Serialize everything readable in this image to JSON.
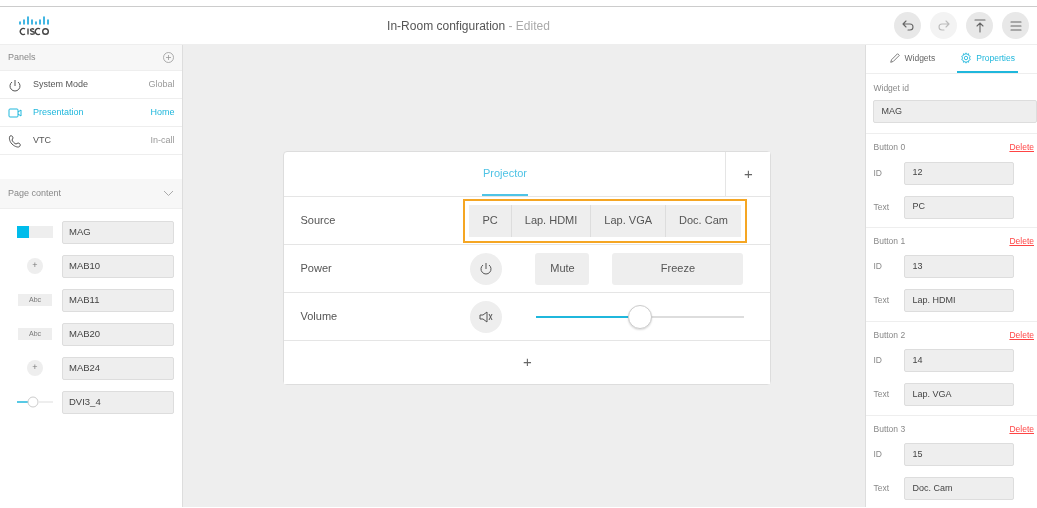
{
  "header": {
    "title": "In-Room configuration",
    "status": "- Edited",
    "actions": [
      {
        "kind": "undo",
        "disabled": false
      },
      {
        "kind": "redo",
        "disabled": true
      },
      {
        "kind": "upload",
        "disabled": false
      },
      {
        "kind": "menu",
        "disabled": false
      }
    ]
  },
  "sidebar": {
    "panels_title": "Panels",
    "panels": [
      {
        "label": "System Mode",
        "scope": "Global",
        "selected": false
      },
      {
        "label": "Presentation",
        "scope": "Home",
        "selected": true
      },
      {
        "label": "VTC",
        "scope": "In-call",
        "selected": false
      }
    ],
    "page_content_title": "Page content",
    "widgets": [
      {
        "kind": "toggle",
        "id": "MAG"
      },
      {
        "kind": "button",
        "id": "MAB10",
        "glyph": "+"
      },
      {
        "kind": "text",
        "id": "MAB11",
        "glyph": "Abc"
      },
      {
        "kind": "text",
        "id": "MAB20",
        "glyph": "Abc"
      },
      {
        "kind": "button",
        "id": "MAB24",
        "glyph": "+"
      },
      {
        "kind": "slider",
        "id": "DVI3_4"
      }
    ]
  },
  "page": {
    "tab": "Projector",
    "add_tab": "+",
    "add_row": "+",
    "rows": [
      {
        "kind": "group",
        "label": "Source",
        "selected": true,
        "buttons": [
          "PC",
          "Lap. HDMI",
          "Lap. VGA",
          "Doc. Cam"
        ]
      },
      {
        "kind": "buttons",
        "label": "Power",
        "selected": false,
        "buttons": [
          "Mute",
          "Freeze"
        ]
      },
      {
        "kind": "slider",
        "label": "Volume",
        "selected": false,
        "level": 0.5
      }
    ]
  },
  "properties": {
    "tabs": [
      {
        "label": "Widgets",
        "selected": false
      },
      {
        "label": "Properties",
        "selected": true
      }
    ],
    "widget_id_label": "Widget id",
    "widget_id": "MAG",
    "buttons": [
      {
        "name": "Button 0",
        "delete": "Delete",
        "id_label": "ID",
        "id": "12",
        "text_label": "Text",
        "text": "PC"
      },
      {
        "name": "Button 1",
        "delete": "Delete",
        "id_label": "ID",
        "id": "13",
        "text_label": "Text",
        "text": "Lap. HDMI"
      },
      {
        "name": "Button 2",
        "delete": "Delete",
        "id_label": "ID",
        "id": "14",
        "text_label": "Text",
        "text": "Lap. VGA"
      },
      {
        "name": "Button 3",
        "delete": "Delete",
        "id_label": "ID",
        "id": "15",
        "text_label": "Text",
        "text": "Doc. Cam"
      }
    ]
  }
}
